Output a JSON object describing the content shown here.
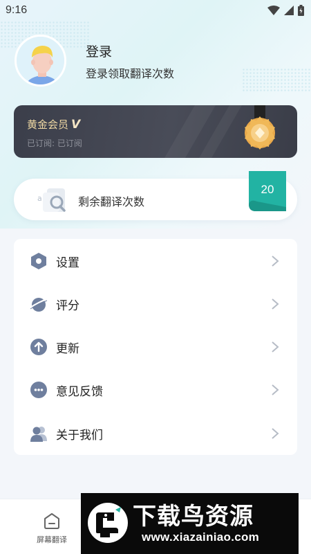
{
  "status_bar": {
    "time": "9:16"
  },
  "profile": {
    "login_title": "登录",
    "login_subtitle": "登录领取翻译次数"
  },
  "vip": {
    "title": "黄金会员",
    "badge": "V",
    "subtitle": "已订阅: 已订阅"
  },
  "remaining": {
    "label": "剩余翻译次数",
    "count": "20"
  },
  "menu": {
    "items": [
      {
        "label": "设置",
        "icon": "settings-icon"
      },
      {
        "label": "评分",
        "icon": "rate-planet-icon"
      },
      {
        "label": "更新",
        "icon": "update-arrow-icon"
      },
      {
        "label": "意见反馈",
        "icon": "feedback-chat-icon"
      },
      {
        "label": "关于我们",
        "icon": "about-users-icon"
      }
    ]
  },
  "bottom_nav": {
    "tab_label": "屏幕翻译"
  },
  "watermark": {
    "title": "下载鸟资源",
    "url": "www.xiazainiao.com"
  },
  "colors": {
    "accent_teal": "#22b3a3",
    "vip_gold": "#f0d9a4",
    "icon_slate": "#6f7f9e"
  }
}
